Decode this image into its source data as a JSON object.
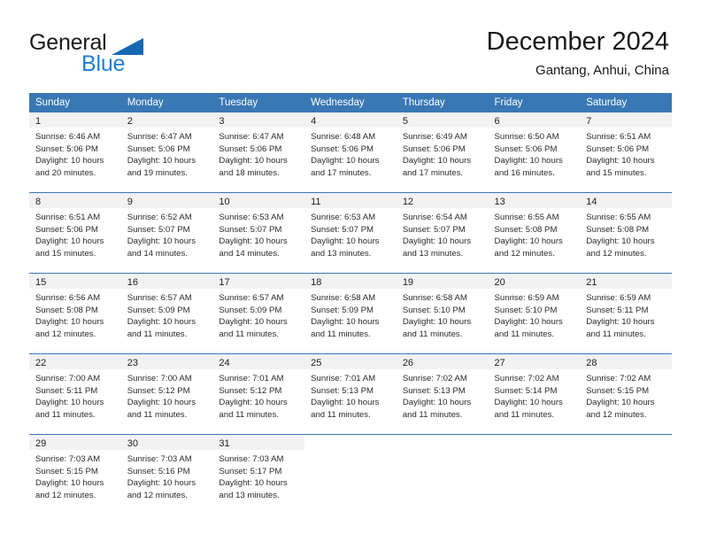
{
  "brand": {
    "word1": "General",
    "word2": "Blue",
    "triangle_color": "#1667b1",
    "blue_color": "#1f7fd4"
  },
  "header": {
    "title": "December 2024",
    "subtitle": "Gantang, Anhui, China"
  },
  "theme": {
    "header_bg": "#3978b4",
    "daynum_bg": "#f2f2f2",
    "row_divider": "#3978b4",
    "text": "#2b2b2b"
  },
  "weekdays": [
    "Sunday",
    "Monday",
    "Tuesday",
    "Wednesday",
    "Thursday",
    "Friday",
    "Saturday"
  ],
  "weeks": [
    [
      {
        "day": "1",
        "sunrise": "Sunrise: 6:46 AM",
        "sunset": "Sunset: 5:06 PM",
        "daylight1": "Daylight: 10 hours",
        "daylight2": "and 20 minutes."
      },
      {
        "day": "2",
        "sunrise": "Sunrise: 6:47 AM",
        "sunset": "Sunset: 5:06 PM",
        "daylight1": "Daylight: 10 hours",
        "daylight2": "and 19 minutes."
      },
      {
        "day": "3",
        "sunrise": "Sunrise: 6:47 AM",
        "sunset": "Sunset: 5:06 PM",
        "daylight1": "Daylight: 10 hours",
        "daylight2": "and 18 minutes."
      },
      {
        "day": "4",
        "sunrise": "Sunrise: 6:48 AM",
        "sunset": "Sunset: 5:06 PM",
        "daylight1": "Daylight: 10 hours",
        "daylight2": "and 17 minutes."
      },
      {
        "day": "5",
        "sunrise": "Sunrise: 6:49 AM",
        "sunset": "Sunset: 5:06 PM",
        "daylight1": "Daylight: 10 hours",
        "daylight2": "and 17 minutes."
      },
      {
        "day": "6",
        "sunrise": "Sunrise: 6:50 AM",
        "sunset": "Sunset: 5:06 PM",
        "daylight1": "Daylight: 10 hours",
        "daylight2": "and 16 minutes."
      },
      {
        "day": "7",
        "sunrise": "Sunrise: 6:51 AM",
        "sunset": "Sunset: 5:06 PM",
        "daylight1": "Daylight: 10 hours",
        "daylight2": "and 15 minutes."
      }
    ],
    [
      {
        "day": "8",
        "sunrise": "Sunrise: 6:51 AM",
        "sunset": "Sunset: 5:06 PM",
        "daylight1": "Daylight: 10 hours",
        "daylight2": "and 15 minutes."
      },
      {
        "day": "9",
        "sunrise": "Sunrise: 6:52 AM",
        "sunset": "Sunset: 5:07 PM",
        "daylight1": "Daylight: 10 hours",
        "daylight2": "and 14 minutes."
      },
      {
        "day": "10",
        "sunrise": "Sunrise: 6:53 AM",
        "sunset": "Sunset: 5:07 PM",
        "daylight1": "Daylight: 10 hours",
        "daylight2": "and 14 minutes."
      },
      {
        "day": "11",
        "sunrise": "Sunrise: 6:53 AM",
        "sunset": "Sunset: 5:07 PM",
        "daylight1": "Daylight: 10 hours",
        "daylight2": "and 13 minutes."
      },
      {
        "day": "12",
        "sunrise": "Sunrise: 6:54 AM",
        "sunset": "Sunset: 5:07 PM",
        "daylight1": "Daylight: 10 hours",
        "daylight2": "and 13 minutes."
      },
      {
        "day": "13",
        "sunrise": "Sunrise: 6:55 AM",
        "sunset": "Sunset: 5:08 PM",
        "daylight1": "Daylight: 10 hours",
        "daylight2": "and 12 minutes."
      },
      {
        "day": "14",
        "sunrise": "Sunrise: 6:55 AM",
        "sunset": "Sunset: 5:08 PM",
        "daylight1": "Daylight: 10 hours",
        "daylight2": "and 12 minutes."
      }
    ],
    [
      {
        "day": "15",
        "sunrise": "Sunrise: 6:56 AM",
        "sunset": "Sunset: 5:08 PM",
        "daylight1": "Daylight: 10 hours",
        "daylight2": "and 12 minutes."
      },
      {
        "day": "16",
        "sunrise": "Sunrise: 6:57 AM",
        "sunset": "Sunset: 5:09 PM",
        "daylight1": "Daylight: 10 hours",
        "daylight2": "and 11 minutes."
      },
      {
        "day": "17",
        "sunrise": "Sunrise: 6:57 AM",
        "sunset": "Sunset: 5:09 PM",
        "daylight1": "Daylight: 10 hours",
        "daylight2": "and 11 minutes."
      },
      {
        "day": "18",
        "sunrise": "Sunrise: 6:58 AM",
        "sunset": "Sunset: 5:09 PM",
        "daylight1": "Daylight: 10 hours",
        "daylight2": "and 11 minutes."
      },
      {
        "day": "19",
        "sunrise": "Sunrise: 6:58 AM",
        "sunset": "Sunset: 5:10 PM",
        "daylight1": "Daylight: 10 hours",
        "daylight2": "and 11 minutes."
      },
      {
        "day": "20",
        "sunrise": "Sunrise: 6:59 AM",
        "sunset": "Sunset: 5:10 PM",
        "daylight1": "Daylight: 10 hours",
        "daylight2": "and 11 minutes."
      },
      {
        "day": "21",
        "sunrise": "Sunrise: 6:59 AM",
        "sunset": "Sunset: 5:11 PM",
        "daylight1": "Daylight: 10 hours",
        "daylight2": "and 11 minutes."
      }
    ],
    [
      {
        "day": "22",
        "sunrise": "Sunrise: 7:00 AM",
        "sunset": "Sunset: 5:11 PM",
        "daylight1": "Daylight: 10 hours",
        "daylight2": "and 11 minutes."
      },
      {
        "day": "23",
        "sunrise": "Sunrise: 7:00 AM",
        "sunset": "Sunset: 5:12 PM",
        "daylight1": "Daylight: 10 hours",
        "daylight2": "and 11 minutes."
      },
      {
        "day": "24",
        "sunrise": "Sunrise: 7:01 AM",
        "sunset": "Sunset: 5:12 PM",
        "daylight1": "Daylight: 10 hours",
        "daylight2": "and 11 minutes."
      },
      {
        "day": "25",
        "sunrise": "Sunrise: 7:01 AM",
        "sunset": "Sunset: 5:13 PM",
        "daylight1": "Daylight: 10 hours",
        "daylight2": "and 11 minutes."
      },
      {
        "day": "26",
        "sunrise": "Sunrise: 7:02 AM",
        "sunset": "Sunset: 5:13 PM",
        "daylight1": "Daylight: 10 hours",
        "daylight2": "and 11 minutes."
      },
      {
        "day": "27",
        "sunrise": "Sunrise: 7:02 AM",
        "sunset": "Sunset: 5:14 PM",
        "daylight1": "Daylight: 10 hours",
        "daylight2": "and 11 minutes."
      },
      {
        "day": "28",
        "sunrise": "Sunrise: 7:02 AM",
        "sunset": "Sunset: 5:15 PM",
        "daylight1": "Daylight: 10 hours",
        "daylight2": "and 12 minutes."
      }
    ],
    [
      {
        "day": "29",
        "sunrise": "Sunrise: 7:03 AM",
        "sunset": "Sunset: 5:15 PM",
        "daylight1": "Daylight: 10 hours",
        "daylight2": "and 12 minutes."
      },
      {
        "day": "30",
        "sunrise": "Sunrise: 7:03 AM",
        "sunset": "Sunset: 5:16 PM",
        "daylight1": "Daylight: 10 hours",
        "daylight2": "and 12 minutes."
      },
      {
        "day": "31",
        "sunrise": "Sunrise: 7:03 AM",
        "sunset": "Sunset: 5:17 PM",
        "daylight1": "Daylight: 10 hours",
        "daylight2": "and 13 minutes."
      },
      {
        "day": "",
        "sunrise": "",
        "sunset": "",
        "daylight1": "",
        "daylight2": ""
      },
      {
        "day": "",
        "sunrise": "",
        "sunset": "",
        "daylight1": "",
        "daylight2": ""
      },
      {
        "day": "",
        "sunrise": "",
        "sunset": "",
        "daylight1": "",
        "daylight2": ""
      },
      {
        "day": "",
        "sunrise": "",
        "sunset": "",
        "daylight1": "",
        "daylight2": ""
      }
    ]
  ]
}
